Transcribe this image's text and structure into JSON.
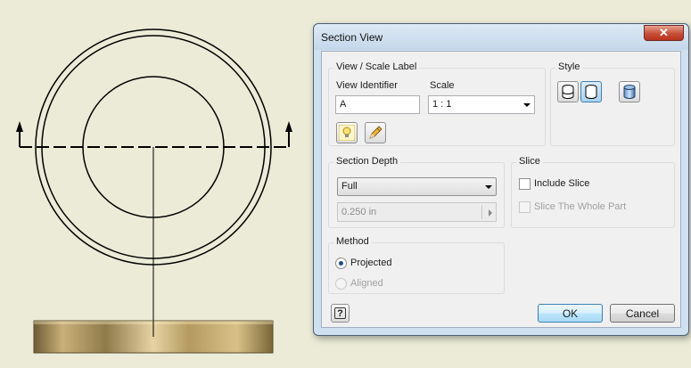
{
  "colors": {
    "background": "#ebebd8",
    "drawing_line": "#000000",
    "part_gold": "#b89e5e",
    "dialog_frame": "#cfe0f0",
    "close_red": "#c65037",
    "selected_blue": "#a9d1f3"
  },
  "drawing": {
    "description_icons": [
      "section-arrow-left-icon",
      "section-arrow-right-icon"
    ]
  },
  "dialog": {
    "title": "Section View",
    "close_glyph": "✕",
    "view_scale": {
      "legend": "View / Scale Label",
      "view_identifier_label": "View Identifier",
      "view_identifier_value": "A",
      "scale_label": "Scale",
      "scale_value": "1 : 1"
    },
    "style": {
      "legend": "Style"
    },
    "section_depth": {
      "legend": "Section Depth",
      "type_value": "Full",
      "distance_value": "0.250 in"
    },
    "slice": {
      "legend": "Slice",
      "include_slice": "Include Slice",
      "slice_whole_part": "Slice The Whole Part"
    },
    "method": {
      "legend": "Method",
      "projected": "Projected",
      "aligned": "Aligned"
    },
    "help_glyph": "?",
    "ok_label": "OK",
    "cancel_label": "Cancel"
  }
}
